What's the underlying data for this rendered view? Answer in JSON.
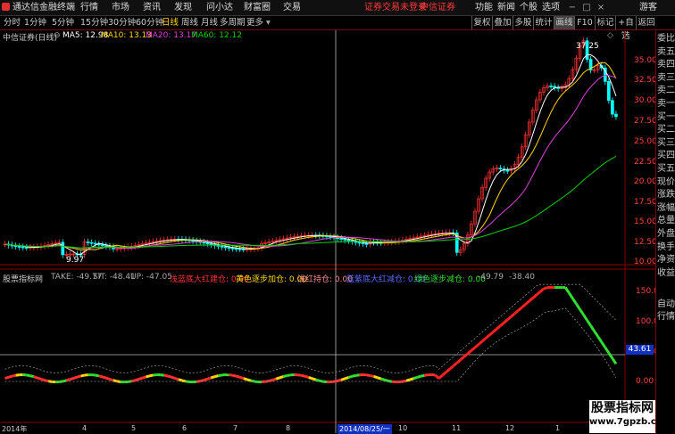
{
  "menubar": {
    "logo": "通达信金融终端",
    "items": [
      "行情",
      "市场",
      "资讯",
      "发现",
      "问小达",
      "财富圈",
      "交易"
    ],
    "login_warning": "证券交易未登录",
    "broker": "中信证券",
    "right_items": [
      "功能",
      "新闻",
      "个股",
      "选项"
    ],
    "guest": "游客"
  },
  "toolbar": {
    "periods": [
      "分时",
      "1分钟",
      "5分钟",
      "15分钟",
      "30分钟",
      "60分钟",
      "日线",
      "周线",
      "月线",
      "多周期",
      "更多"
    ],
    "active_period": "日线",
    "right_buttons": [
      "复权",
      "叠加",
      "多股",
      "统计",
      "画线",
      "F10",
      "标记",
      "+自选",
      "返回"
    ]
  },
  "main_chart": {
    "stock_label": "中信证券(日线)",
    "ma5_label": "MA5: 12.98",
    "ma10_label": "MA10: 13.13",
    "ma20_label": "MA20: 13.17",
    "ma60_label": "MA60: 12.12",
    "high_label": "37.25",
    "low_label": "9.97",
    "y_ticks": [
      "35.00",
      "32.50",
      "30.00",
      "27.50",
      "25.00",
      "22.50",
      "20.00",
      "17.50",
      "15.00",
      "12.50",
      "10.00"
    ],
    "colors": {
      "ma5": "#ffffff",
      "ma10": "#ffd700",
      "ma20": "#e040e0",
      "ma60": "#00d000",
      "up": "#ff3030",
      "down": "#00ffff"
    }
  },
  "indicator": {
    "title": "股票指标网",
    "take": "TAKE: -49.77",
    "sit": "SIT: -48.41",
    "up": "UP: -47.05",
    "light_blue_build": "浅蓝底大红建仓: 0.00",
    "yellow_add": "黄色逐步加仓: 0.00",
    "light_red_hold": "浅红持仓: 0.00",
    "blue_big_reduce": "蓝紫底大红减仓: 0.00",
    "green_reduce": "绿色逐步减仓: 0.00",
    "v1": "-49.79",
    "v2": "-38.40",
    "y_ticks": [
      "150.00",
      "100.00",
      "50.00",
      "0.00"
    ],
    "marker_value": "43.61"
  },
  "x_axis": {
    "labels": [
      "2014年",
      "4",
      "5",
      "6",
      "7",
      "8",
      "9",
      "10",
      "11",
      "12",
      "1"
    ],
    "crosshair_date": "2014/08/25/一"
  },
  "sidebar": {
    "items": [
      "委比",
      "卖五",
      "卖四",
      "卖三",
      "卖二",
      "卖一",
      "买一",
      "买二",
      "买三",
      "买四",
      "买五",
      "现价",
      "涨跌",
      "涨幅",
      "总量",
      "外盘",
      "换手",
      "净资",
      "收益"
    ],
    "bottom_items": [
      "自动",
      "行情"
    ]
  },
  "watermark": {
    "line1": "股票指标网",
    "line2": "www.7gpzb.com"
  }
}
